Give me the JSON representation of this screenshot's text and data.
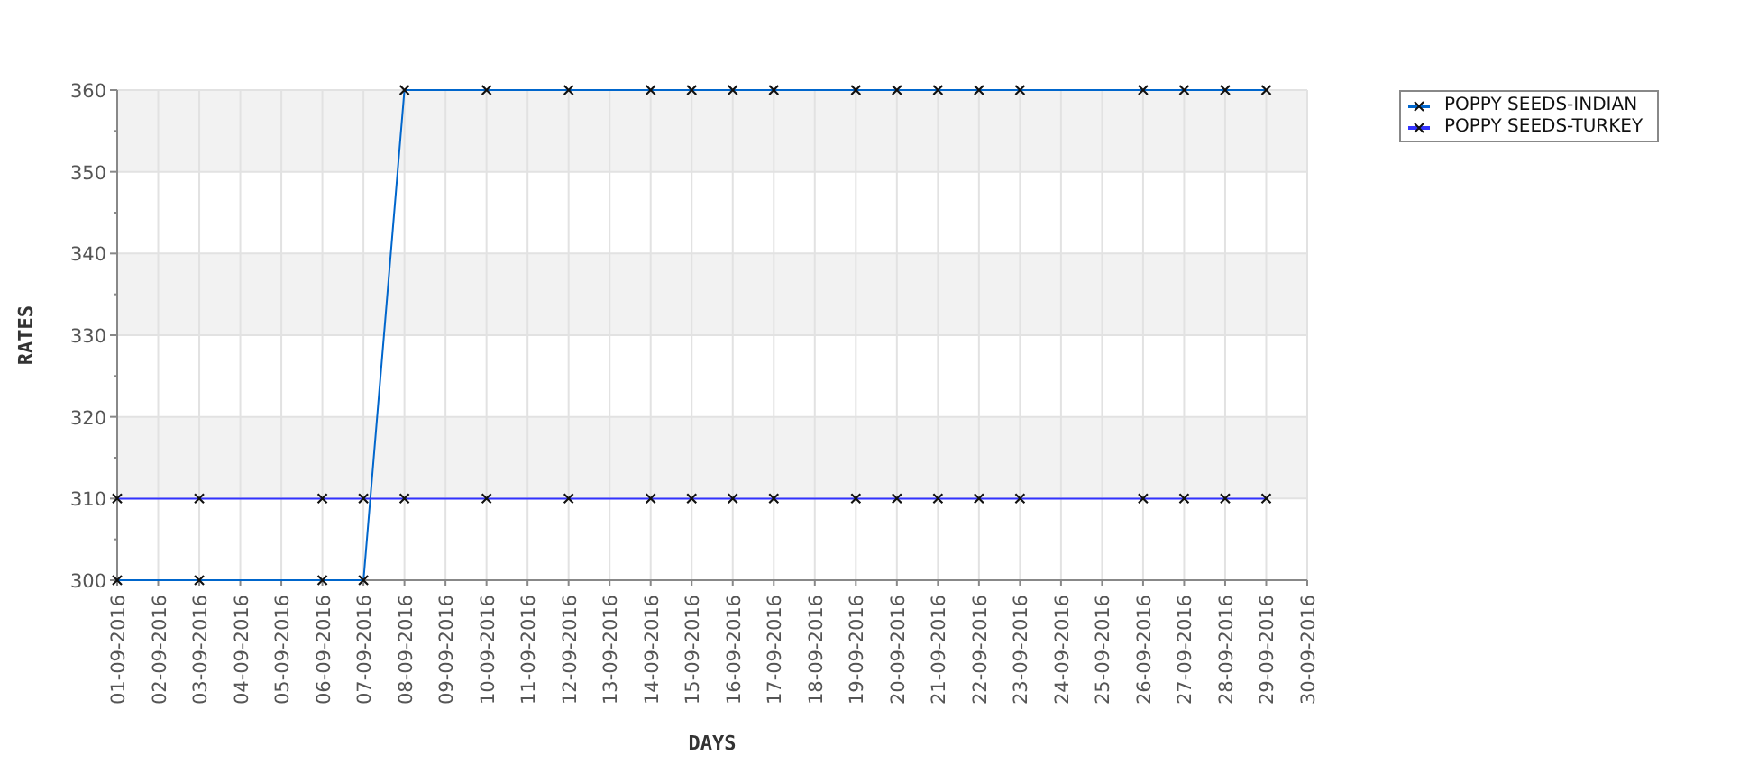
{
  "chart": {
    "chart_data": {
      "type": "line",
      "xlabel": "DAYS",
      "ylabel": "RATES",
      "grid": true,
      "categories": [
        "01-09-2016",
        "02-09-2016",
        "03-09-2016",
        "04-09-2016",
        "05-09-2016",
        "06-09-2016",
        "07-09-2016",
        "08-09-2016",
        "09-09-2016",
        "10-09-2016",
        "11-09-2016",
        "12-09-2016",
        "13-09-2016",
        "14-09-2016",
        "15-09-2016",
        "16-09-2016",
        "17-09-2016",
        "18-09-2016",
        "19-09-2016",
        "20-09-2016",
        "21-09-2016",
        "22-09-2016",
        "23-09-2016",
        "24-09-2016",
        "25-09-2016",
        "26-09-2016",
        "27-09-2016",
        "28-09-2016",
        "29-09-2016",
        "30-09-2016"
      ],
      "series": [
        {
          "name": "POPPY SEEDS-INDIAN",
          "color": "#0066cc",
          "marker": "x",
          "values": [
            300,
            null,
            300,
            null,
            null,
            300,
            300,
            360,
            null,
            360,
            null,
            360,
            null,
            360,
            360,
            360,
            360,
            null,
            360,
            360,
            360,
            360,
            360,
            null,
            null,
            360,
            360,
            360,
            360,
            null
          ]
        },
        {
          "name": "POPPY SEEDS-TURKEY",
          "color": "#3333ff",
          "marker": "x",
          "values": [
            310,
            null,
            310,
            null,
            null,
            310,
            310,
            310,
            null,
            310,
            null,
            310,
            null,
            310,
            310,
            310,
            310,
            null,
            310,
            310,
            310,
            310,
            310,
            null,
            null,
            310,
            310,
            310,
            310,
            null
          ]
        }
      ],
      "ylim": [
        300,
        360
      ],
      "yticks": [
        300,
        310,
        320,
        330,
        340,
        350,
        360
      ]
    }
  }
}
